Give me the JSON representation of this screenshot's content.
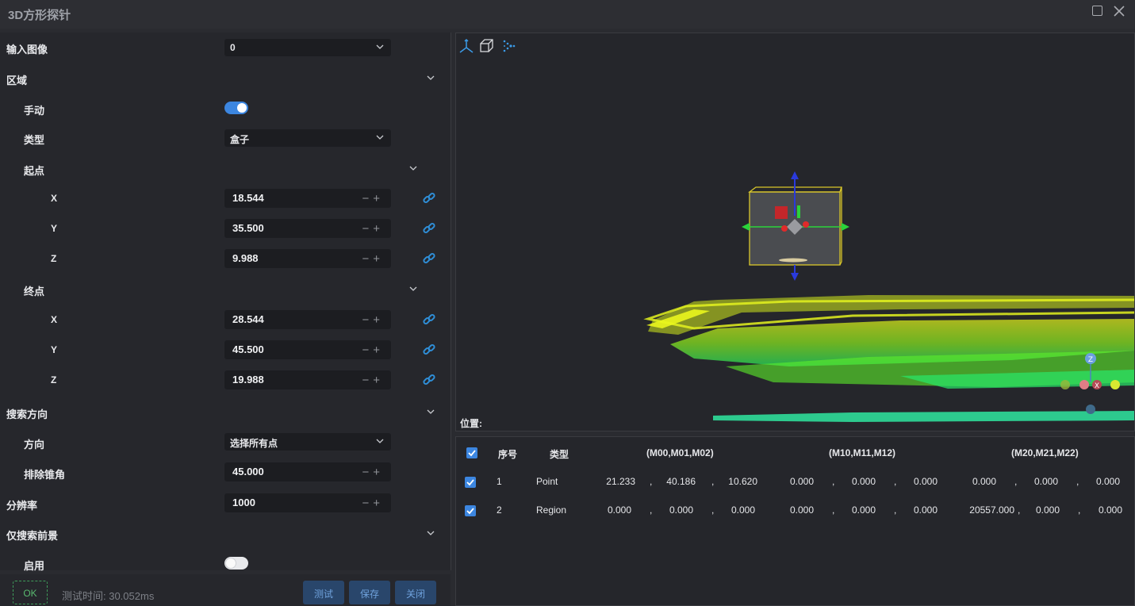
{
  "window": {
    "title": "3D方形探针"
  },
  "form": {
    "input_image": {
      "label": "输入图像",
      "value": "0"
    },
    "region": {
      "label": "区域"
    },
    "manual": {
      "label": "手动",
      "enabled": true
    },
    "type": {
      "label": "类型",
      "value": "盒子"
    },
    "start": {
      "label": "起点",
      "x_label": "X",
      "x": "18.544",
      "y_label": "Y",
      "y": "35.500",
      "z_label": "Z",
      "z": "9.988"
    },
    "end": {
      "label": "终点",
      "x_label": "X",
      "x": "28.544",
      "y_label": "Y",
      "y": "45.500",
      "z_label": "Z",
      "z": "19.988"
    },
    "search_direction": {
      "label": "搜索方向"
    },
    "direction": {
      "label": "方向",
      "value": "选择所有点"
    },
    "exclude_cone": {
      "label": "排除锥角",
      "value": "45.000"
    },
    "resolution": {
      "label": "分辨率",
      "value": "1000"
    },
    "foreground_only": {
      "label": "仅搜索前景"
    },
    "enable": {
      "label": "启用",
      "enabled": false
    }
  },
  "footer": {
    "status": "OK",
    "test_time": "测试时间: 30.052ms",
    "test_button": "测试",
    "save_button": "保存",
    "close_button": "关闭"
  },
  "viewer": {
    "position_label": "位置:",
    "gizmo_z": "Z",
    "gizmo_x": "X"
  },
  "results_table": {
    "headers": {
      "index": "序号",
      "type": "类型",
      "m0": "(M00,M01,M02)",
      "m1": "(M10,M11,M12)",
      "m2": "(M20,M21,M22)"
    },
    "separator": ",",
    "rows": [
      {
        "checked": true,
        "index": "1",
        "type": "Point",
        "m0": [
          "21.233",
          "40.186",
          "10.620"
        ],
        "m1": [
          "0.000",
          "0.000",
          "0.000"
        ],
        "m2": [
          "0.000",
          "0.000",
          "0.000"
        ]
      },
      {
        "checked": true,
        "index": "2",
        "type": "Region",
        "m0": [
          "0.000",
          "0.000",
          "0.000"
        ],
        "m1": [
          "0.000",
          "0.000",
          "0.000"
        ],
        "m2": [
          "20557.000",
          "0.000",
          "0.000"
        ]
      }
    ]
  },
  "colors": {
    "accent": "#3c86e0",
    "ok_green": "#59b86f",
    "link_blue": "#2f8fd8"
  },
  "icons": [
    "axes-icon",
    "box-view-icon",
    "points-icon",
    "chevron-down-icon",
    "link-icon",
    "maximize-icon",
    "close-icon",
    "checkbox-checked-icon"
  ]
}
